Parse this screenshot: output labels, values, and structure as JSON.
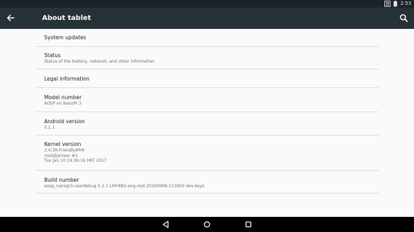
{
  "status_bar": {
    "time": "2:53"
  },
  "app_bar": {
    "title": "About tablet"
  },
  "items": [
    {
      "title": "System updates",
      "summary": []
    },
    {
      "title": "Status",
      "summary": [
        "Status of the battery, network, and other information"
      ]
    },
    {
      "title": "Legal information",
      "summary": []
    },
    {
      "title": "Model number",
      "summary": [
        "AOSP on NanoPi 3"
      ]
    },
    {
      "title": "Android version",
      "summary": [
        "5.1.1"
      ]
    },
    {
      "title": "Kernel version",
      "summary": [
        "3.4.39-FriendlyARM",
        "root@jensen #1",
        "Tue Jan 10 19:36:16 HKT 2017"
      ]
    },
    {
      "title": "Build number",
      "summary": [
        "aosp_nanopi3-userdebug 5.1.1 LMY48G eng.root.20160906.113950 dev-keys"
      ]
    }
  ]
}
